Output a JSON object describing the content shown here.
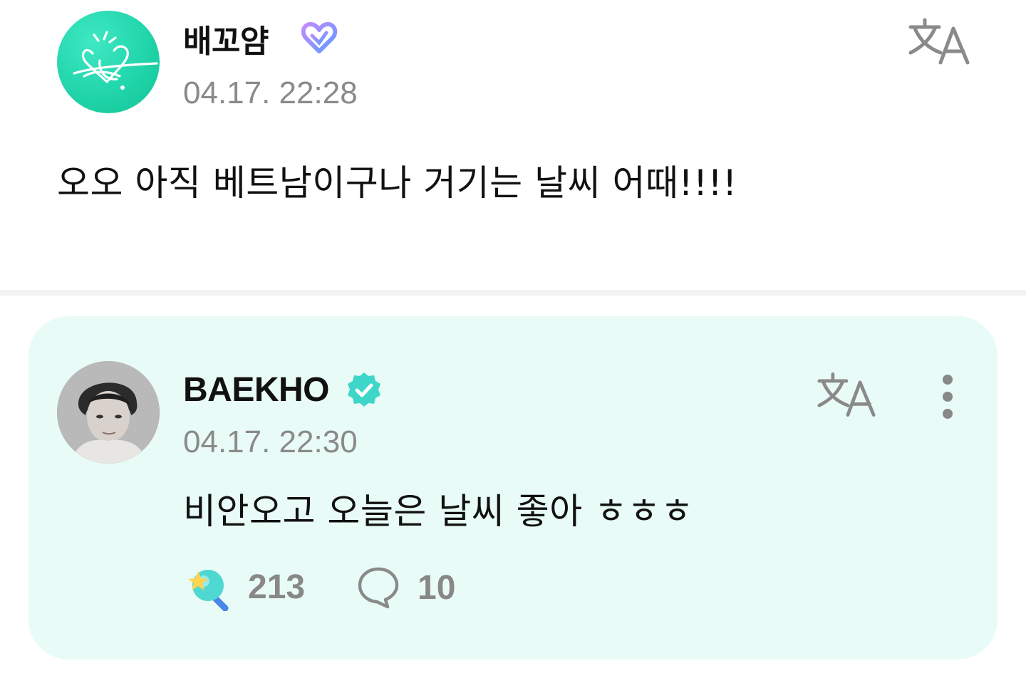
{
  "post": {
    "author_name": "배꼬얌",
    "timestamp": "04.17. 22:28",
    "body": "오오 아직 베트남이구나 거기는 날씨 어때!!!!",
    "avatar_icon": "heart-logo-icon",
    "badge_icon": "fan-membership-badge-icon",
    "translate_icon": "translate-icon"
  },
  "comment": {
    "author_name": "BAEKHO",
    "timestamp": "04.17. 22:30",
    "body": "비안오고 오늘은 날씨 좋아 ㅎㅎㅎ",
    "badge_icon": "verified-badge-icon",
    "translate_icon": "translate-icon",
    "more_icon": "more-vertical-icon",
    "likes": "213",
    "comments": "10",
    "like_icon": "like-lightstick-icon",
    "comment_icon": "comment-bubble-icon"
  },
  "colors": {
    "card_bg": "#e9fbf6",
    "accent": "#2fd3c0",
    "muted": "#8a8a8a",
    "verified": "#3ed6c9",
    "membership_gradient": [
      "#c38bff",
      "#5f9bff"
    ]
  }
}
